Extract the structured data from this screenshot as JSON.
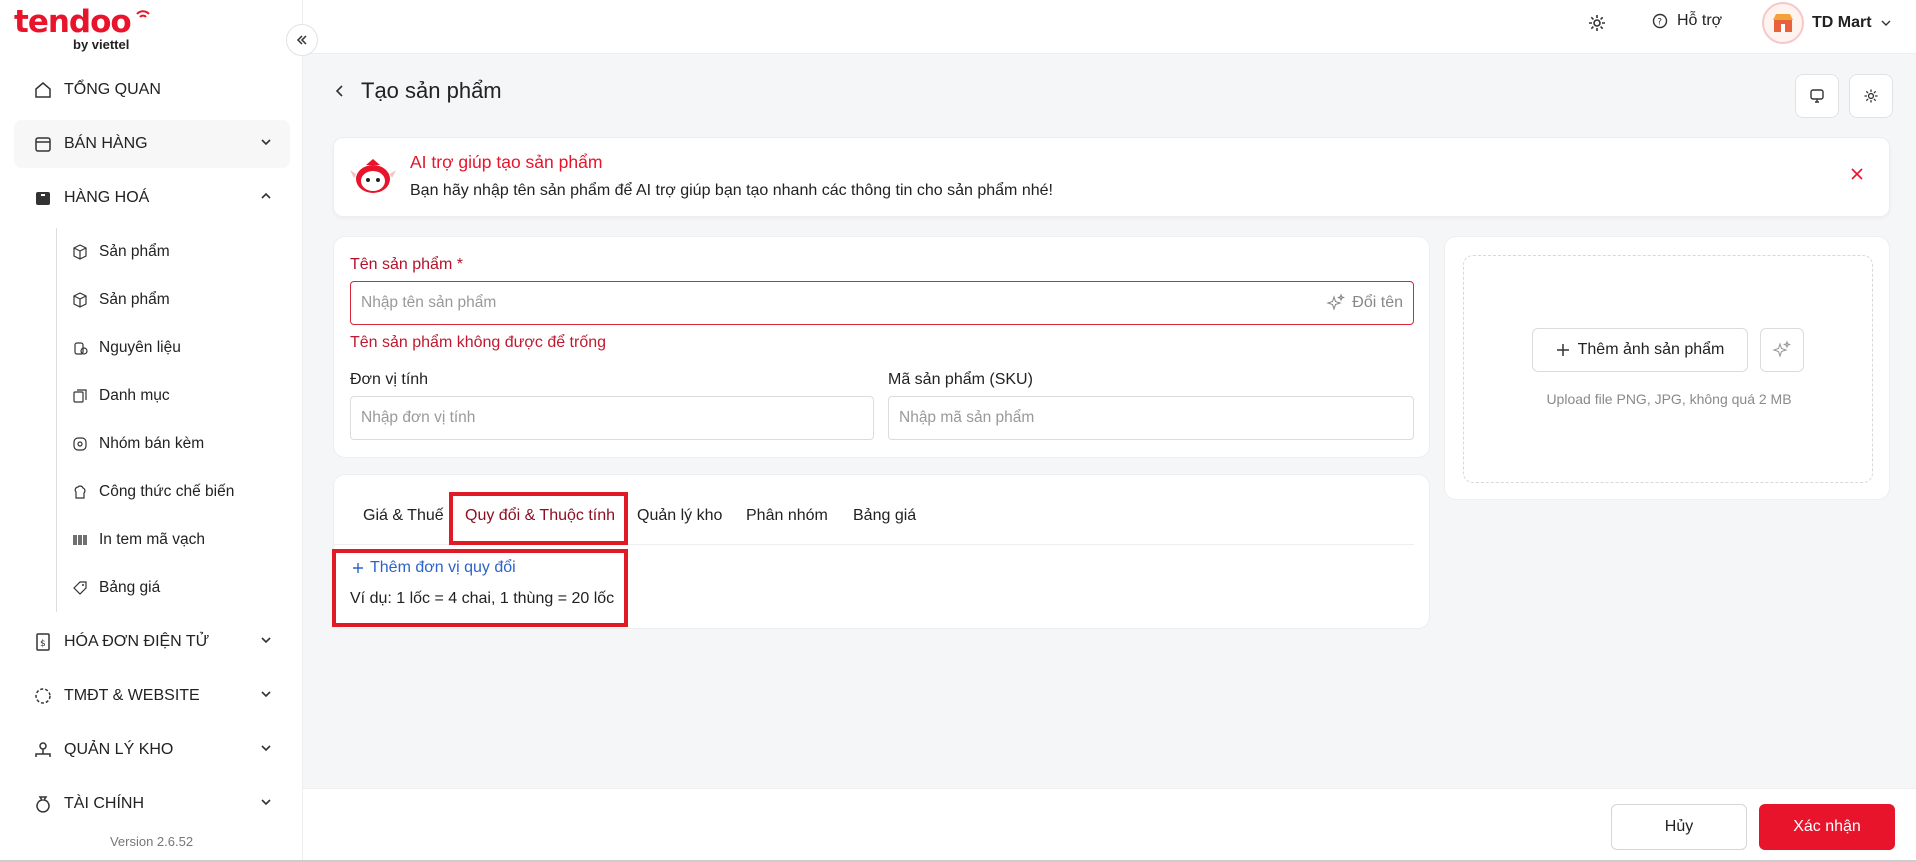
{
  "brand": {
    "name": "tendoo",
    "sub": "by viettel"
  },
  "nav": {
    "overview": "TỔNG QUAN",
    "sales": "BÁN HÀNG",
    "goods": "HÀNG HOÁ",
    "sub_items": [
      "Sản phẩm",
      "Sản phẩm",
      "Nguyên liệu",
      "Danh mục",
      "Nhóm bán kèm",
      "Công thức chế biến",
      "In tem mã vạch",
      "Bảng giá"
    ],
    "einvoice": "HÓA ĐƠN ĐIỆN TỬ",
    "ecommerce": "TMĐT & WEBSITE",
    "warehouse": "QUẢN LÝ KHO",
    "finance": "TÀI CHÍNH"
  },
  "version": "Version 2.6.52",
  "topbar": {
    "help": "Hỗ trợ",
    "user": "TD Mart"
  },
  "page": {
    "title": "Tạo sản phẩm"
  },
  "ai_banner": {
    "title": "AI trợ giúp tạo sản phẩm",
    "desc": "Bạn hãy nhập tên sản phẩm để AI trợ giúp bạn tạo nhanh các thông tin cho sản phẩm nhé!"
  },
  "form": {
    "name_label": "Tên sản phẩm *",
    "name_placeholder": "Nhập tên sản phẩm",
    "rename": "Đổi tên",
    "name_error": "Tên sản phẩm không được để trống",
    "unit_label": "Đơn vị tính",
    "unit_placeholder": "Nhập đơn vị tính",
    "sku_label": "Mã sản phẩm (SKU)",
    "sku_placeholder": "Nhập mã sản phẩm"
  },
  "image": {
    "add": "Thêm ảnh sản phẩm",
    "hint": "Upload file PNG, JPG, không quá 2 MB"
  },
  "tabs": [
    "Giá & Thuế",
    "Quy đổi & Thuộc tính",
    "Quản lý kho",
    "Phân nhóm",
    "Bảng giá"
  ],
  "conversion": {
    "add": "Thêm đơn vị quy đổi",
    "example": "Ví dụ: 1 lốc = 4 chai, 1 thùng = 20 lốc"
  },
  "footer": {
    "cancel": "Hủy",
    "confirm": "Xác nhận"
  },
  "colors": {
    "brand": "#e8142c",
    "highlight": "#e01b25",
    "link": "#2c63c9"
  }
}
